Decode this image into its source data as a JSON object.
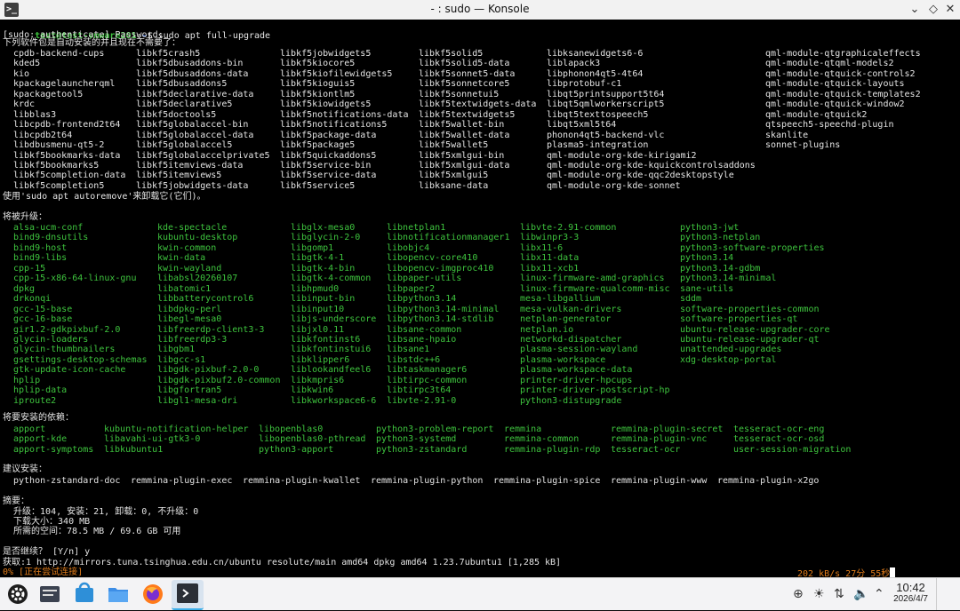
{
  "window": {
    "title": "- : sudo — Konsole"
  },
  "prompt": {
    "user_host": "test@test-vmware201",
    "path": "~",
    "symbol": "$",
    "command": "sudo apt full-upgrade"
  },
  "lines": {
    "sudo_prompt": "[sudo: authenticate] Password:",
    "autoremove_header": "下列软件包是自动安装的并且现在不需要了：",
    "autoremove_hint": "使用'sudo apt autoremove'来卸载它(它们)。",
    "upgrade_header": "将被升级：",
    "deps_header": "将要安装的依赖：",
    "suggest_header": "建议安装：",
    "summary_header": "摘要：",
    "summary_counts": "  升级：104, 安装：21, 卸载：0, 不升级：0",
    "summary_download": "  下载大小：340 MB",
    "summary_space": "  所需的空间：78.5 MB / 69.6 GB 可用",
    "continue_prompt": "是否继续？ [Y/n] y",
    "fetch_line": "获取:1 http://mirrors.tuna.tsinghua.edu.cn/ubuntu resolute/main amd64 dpkg amd64 1.23.7ubuntu1 [1,285 kB]",
    "progress_left": "0% [正在尝试连接]",
    "progress_right": "202 kB/s 27分 55秒"
  },
  "autoremove_rows": [
    [
      "cpdb-backend-cups",
      "libkf5crash5",
      "libkf5jobwidgets5",
      "libkf5solid5",
      "libksanewidgets6-6",
      "qml-module-qtgraphicaleffects"
    ],
    [
      "kded5",
      "libkf5dbusaddons-bin",
      "libkf5kiocore5",
      "libkf5solid5-data",
      "liblapack3",
      "qml-module-qtqml-models2"
    ],
    [
      "kio",
      "libkf5dbusaddons-data",
      "libkf5kiofilewidgets5",
      "libkf5sonnet5-data",
      "libphonon4qt5-4t64",
      "qml-module-qtquick-controls2"
    ],
    [
      "kpackagelauncherqml",
      "libkf5dbusaddons5",
      "libkf5kioguis5",
      "libkf5sonnetcore5",
      "libprotobuf-c1",
      "qml-module-qtquick-layouts"
    ],
    [
      "kpackagetool5",
      "libkf5declarative-data",
      "libkf5kiontlm5",
      "libkf5sonnetui5",
      "libqt5printsupport5t64",
      "qml-module-qtquick-templates2"
    ],
    [
      "krdc",
      "libkf5declarative5",
      "libkf5kiowidgets5",
      "libkf5textwidgets-data",
      "libqt5qmlworkerscript5",
      "qml-module-qtquick-window2"
    ],
    [
      "libblas3",
      "libkf5doctools5",
      "libkf5notifications-data",
      "libkf5textwidgets5",
      "libqt5texttospeech5",
      "qml-module-qtquick2"
    ],
    [
      "libcpdb-frontend2t64",
      "libkf5globalaccel-bin",
      "libkf5notifications5",
      "libkf5wallet-bin",
      "libqt5xml5t64",
      "qtspeech5-speechd-plugin"
    ],
    [
      "libcpdb2t64",
      "libkf5globalaccel-data",
      "libkf5package-data",
      "libkf5wallet-data",
      "phonon4qt5-backend-vlc",
      "skanlite"
    ],
    [
      "libdbusmenu-qt5-2",
      "libkf5globalaccel5",
      "libkf5package5",
      "libkf5wallet5",
      "plasma5-integration",
      "sonnet-plugins"
    ],
    [
      "libkf5bookmarks-data",
      "libkf5globalaccelprivate5",
      "libkf5quickaddons5",
      "libkf5xmlgui-bin",
      "qml-module-org-kde-kirigami2",
      ""
    ],
    [
      "libkf5bookmarks5",
      "libkf5itemviews-data",
      "libkf5service-bin",
      "libkf5xmlgui-data",
      "qml-module-org-kde-kquickcontrolsaddons",
      ""
    ],
    [
      "libkf5completion-data",
      "libkf5itemviews5",
      "libkf5service-data",
      "libkf5xmlgui5",
      "qml-module-org-kde-qqc2desktopstyle",
      ""
    ],
    [
      "libkf5completion5",
      "libkf5jobwidgets-data",
      "libkf5service5",
      "libksane-data",
      "qml-module-org-kde-sonnet",
      ""
    ]
  ],
  "upgrade_rows": [
    [
      "alsa-ucm-conf",
      "kde-spectacle",
      "libglx-mesa0",
      "libnetplan1",
      "libvte-2.91-common",
      "python3-jwt"
    ],
    [
      "bind9-dnsutils",
      "kubuntu-desktop",
      "libglycin-2-0",
      "libnotificationmanager1",
      "libwinpr3-3",
      "python3-netplan"
    ],
    [
      "bind9-host",
      "kwin-common",
      "libgomp1",
      "libobjc4",
      "libx11-6",
      "python3-software-properties"
    ],
    [
      "bind9-libs",
      "kwin-data",
      "libgtk-4-1",
      "libopencv-core410",
      "libx11-data",
      "python3.14"
    ],
    [
      "cpp-15",
      "kwin-wayland",
      "libgtk-4-bin",
      "libopencv-imgproc410",
      "libx11-xcb1",
      "python3.14-gdbm"
    ],
    [
      "cpp-15-x86-64-linux-gnu",
      "libabsl20260107",
      "libgtk-4-common",
      "libpaper-utils",
      "linux-firmware-amd-graphics",
      "python3.14-minimal"
    ],
    [
      "dpkg",
      "libatomic1",
      "libhpmud0",
      "libpaper2",
      "linux-firmware-qualcomm-misc",
      "sane-utils"
    ],
    [
      "drkonqi",
      "libbatterycontrol6",
      "libinput-bin",
      "libpython3.14",
      "mesa-libgallium",
      "sddm"
    ],
    [
      "gcc-15-base",
      "libdpkg-perl",
      "libinput10",
      "libpython3.14-minimal",
      "mesa-vulkan-drivers",
      "software-properties-common"
    ],
    [
      "gcc-16-base",
      "libegl-mesa0",
      "libjs-underscore",
      "libpython3.14-stdlib",
      "netplan-generator",
      "software-properties-qt"
    ],
    [
      "gir1.2-gdkpixbuf-2.0",
      "libfreerdp-client3-3",
      "libjxl0.11",
      "libsane-common",
      "netplan.io",
      "ubuntu-release-upgrader-core"
    ],
    [
      "glycin-loaders",
      "libfreerdp3-3",
      "libkfontinst6",
      "libsane-hpaio",
      "networkd-dispatcher",
      "ubuntu-release-upgrader-qt"
    ],
    [
      "glycin-thumbnailers",
      "libgbm1",
      "libkfontinstui6",
      "libsane1",
      "plasma-session-wayland",
      "unattended-upgrades"
    ],
    [
      "gsettings-desktop-schemas",
      "libgcc-s1",
      "libklipper6",
      "libstdc++6",
      "plasma-workspace",
      "xdg-desktop-portal"
    ],
    [
      "gtk-update-icon-cache",
      "libgdk-pixbuf-2.0-0",
      "liblookandfeel6",
      "libtaskmanager6",
      "plasma-workspace-data",
      ""
    ],
    [
      "hplip",
      "libgdk-pixbuf2.0-common",
      "libkmpris6",
      "libtirpc-common",
      "printer-driver-hpcups",
      ""
    ],
    [
      "hplip-data",
      "libgfortran5",
      "libkwin6",
      "libtirpc3t64",
      "printer-driver-postscript-hp",
      ""
    ],
    [
      "iproute2",
      "libgl1-mesa-dri",
      "libkworkspace6-6",
      "libvte-2.91-0",
      "python3-distupgrade",
      ""
    ]
  ],
  "deps_rows": [
    [
      "apport",
      "kubuntu-notification-helper",
      "libopenblas0",
      "python3-problem-report",
      "remmina",
      "remmina-plugin-secret",
      "tesseract-ocr-eng"
    ],
    [
      "apport-kde",
      "libavahi-ui-gtk3-0",
      "libopenblas0-pthread",
      "python3-systemd",
      "remmina-common",
      "remmina-plugin-vnc",
      "tesseract-ocr-osd"
    ],
    [
      "apport-symptoms",
      "libkubuntu1",
      "python3-apport",
      "python3-zstandard",
      "remmina-plugin-rdp",
      "tesseract-ocr",
      "user-session-migration"
    ]
  ],
  "suggest_row": [
    "python-zstandard-doc",
    "remmina-plugin-exec",
    "remmina-plugin-kwallet",
    "remmina-plugin-python",
    "remmina-plugin-spice",
    "remmina-plugin-www",
    "remmina-plugin-x2go"
  ],
  "clock": {
    "time": "10:42",
    "date": "2026/4/7"
  },
  "colors": {
    "green": "#3ec43e",
    "text": "#e5e5e5",
    "progress": "#e07c1a",
    "taskbar": "#f3f3f5"
  }
}
